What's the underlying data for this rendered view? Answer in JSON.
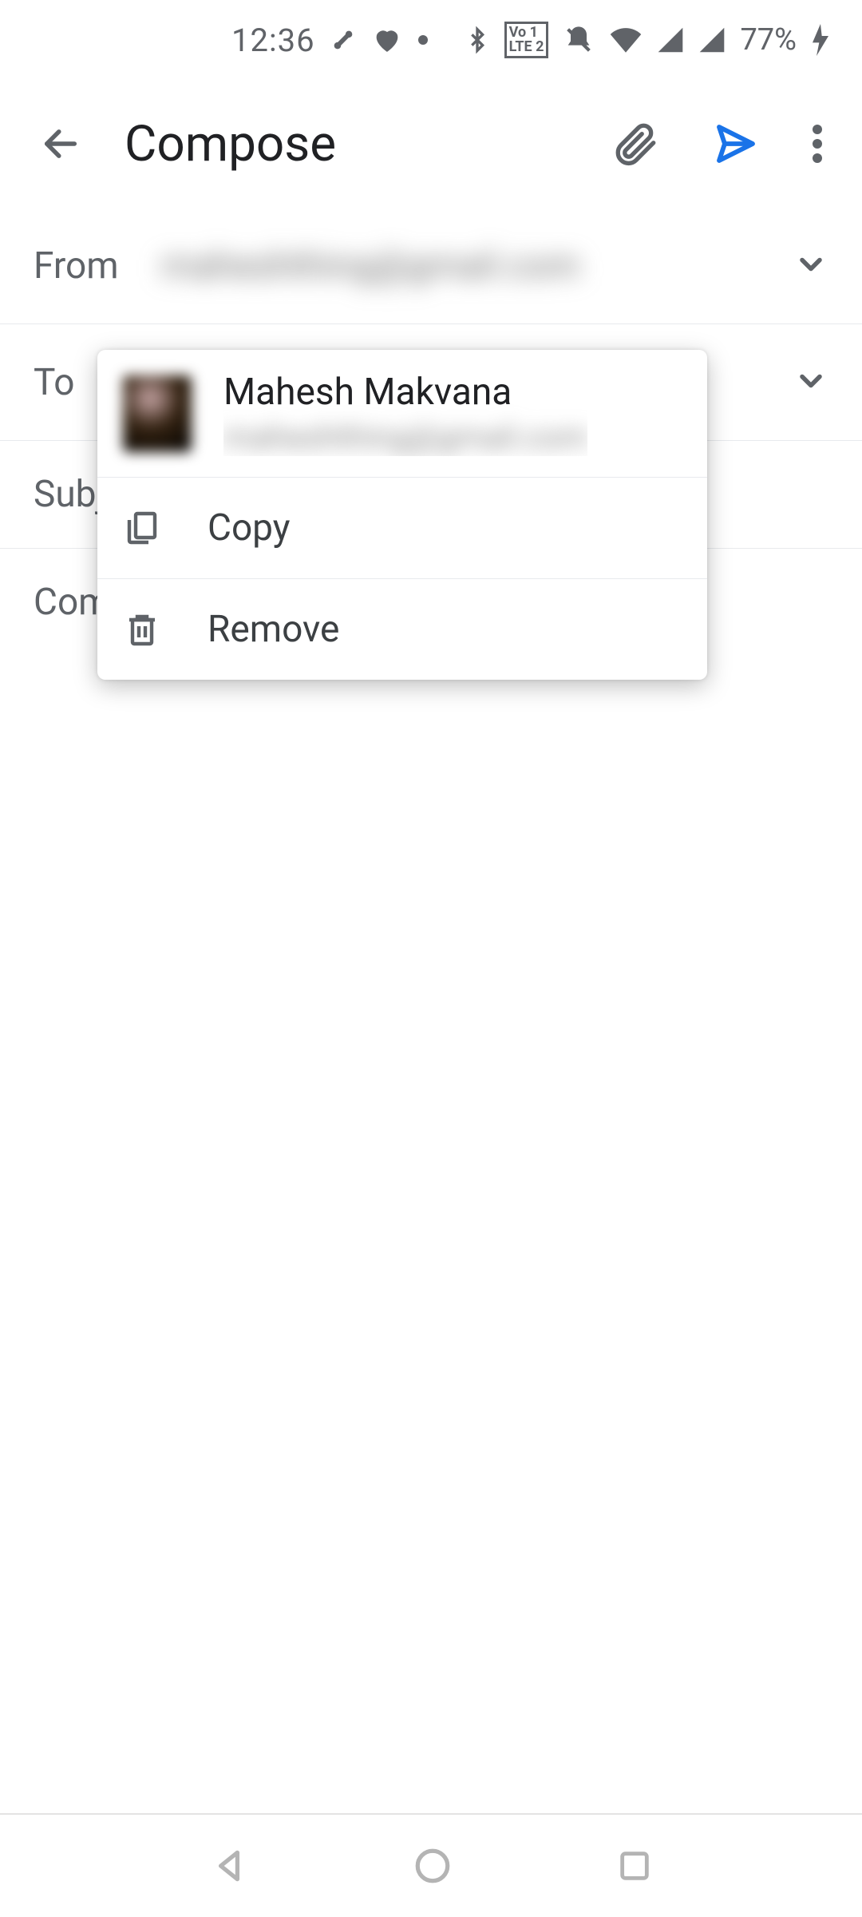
{
  "status": {
    "time": "12:36",
    "battery": "77%"
  },
  "appbar": {
    "title": "Compose"
  },
  "fields": {
    "from_label": "From",
    "from_value": "maheshthing@gmail.com",
    "to_label": "To",
    "subject_placeholder": "Subject",
    "body_placeholder": "Compose email"
  },
  "popup": {
    "contact_name": "Mahesh Makvana",
    "contact_email": "maheshthing@gmail.com",
    "copy_label": "Copy",
    "remove_label": "Remove"
  }
}
